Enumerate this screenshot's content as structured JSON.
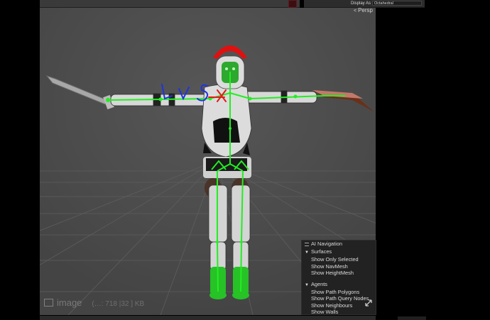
{
  "toolbar": {
    "display_as_label": "Display As",
    "display_as_value": "Octahedral"
  },
  "viewport": {
    "camera_label": "Persp",
    "watermark_label": "image",
    "watermark_meta": "(…: 718 |32 ] KB"
  },
  "annotation": {
    "scribble_text": "L V S"
  },
  "ai_navigation": {
    "title": "AI Navigation",
    "surfaces": {
      "label": "Surfaces",
      "items": [
        "Show Only Selected",
        "Show NavMesh",
        "Show HeightMesh"
      ]
    },
    "agents": {
      "label": "Agents",
      "items": [
        "Show Path Polygons",
        "Show Path Query Nodes",
        "Show Neighbours",
        "Show Walls"
      ]
    }
  },
  "colors": {
    "bone": "#22dd22",
    "armor": "#d8d8d8",
    "plume": "#e01010",
    "face": "#2ea82e",
    "annotation_pen": "#2233dd",
    "grid": "#5a5a5a"
  }
}
